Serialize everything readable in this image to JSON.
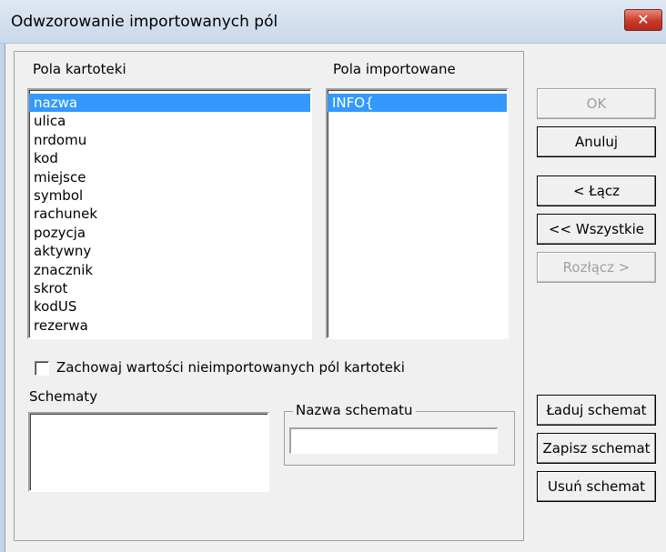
{
  "window": {
    "title": "Odwzorowanie importowanych pól",
    "close_label": "✕"
  },
  "lists": {
    "kartoteki_label": "Pola kartoteki",
    "kartoteki_items": [
      "nazwa",
      "ulica",
      "nrdomu",
      "kod",
      "miejsce",
      "symbol",
      "rachunek",
      "pozycja",
      "aktywny",
      "znacznik",
      "skrot",
      "kodUS",
      "rezerwa"
    ],
    "kartoteki_selected": "nazwa",
    "importowane_label": "Pola importowane",
    "importowane_items": [
      "INFO{"
    ],
    "importowane_selected": "INFO{"
  },
  "buttons": {
    "ok": "OK",
    "anuluj": "Anuluj",
    "lacz": "< Łącz",
    "wszystkie": "<< Wszystkie",
    "rozlacz": "Rozłącz >",
    "laduj": "Ładuj schemat",
    "zapisz": "Zapisz schemat",
    "usun": "Usuń schemat"
  },
  "checkbox": {
    "label": "Zachowaj wartości nieimportowanych pól kartoteki",
    "checked": false
  },
  "schematy": {
    "label": "Schematy",
    "name_legend": "Nazwa schematu",
    "name_value": ""
  }
}
